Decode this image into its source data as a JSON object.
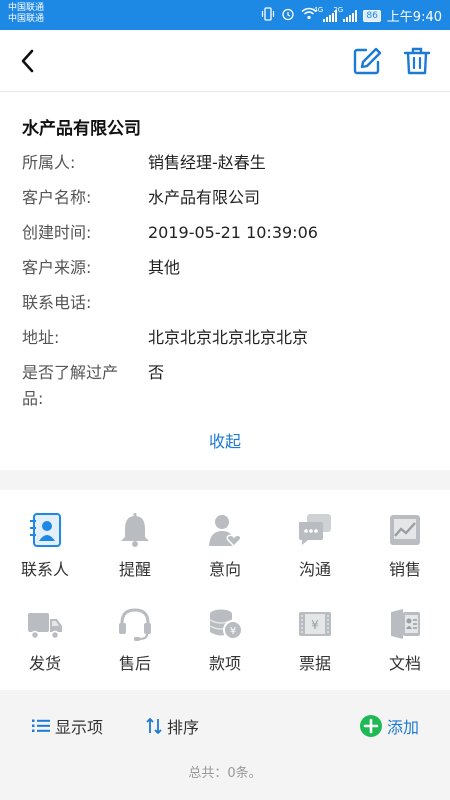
{
  "status_bar": {
    "carrier_1": "中国联通",
    "carrier_2": "中国联通",
    "signal_1_tag": "4G",
    "signal_2_tag": "2G",
    "battery": "86",
    "time": "上午9:40"
  },
  "colors": {
    "accent": "#1e88e5",
    "link": "#1c7ad4",
    "add_green": "#1db954"
  },
  "header": {
    "back_icon": "chevron-left-icon",
    "edit_icon": "edit-icon",
    "delete_icon": "trash-icon"
  },
  "customer": {
    "title": "水产品有限公司",
    "fields": [
      {
        "label": "所属人:",
        "value": "销售经理-赵春生"
      },
      {
        "label": "客户名称:",
        "value": "水产品有限公司"
      },
      {
        "label": "创建时间:",
        "value": "2019-05-21 10:39:06"
      },
      {
        "label": "客户来源:",
        "value": "其他"
      },
      {
        "label": "联系电话:",
        "value": ""
      },
      {
        "label": "地址:",
        "value": "北京北京北京北京北京"
      },
      {
        "label": "是否了解过产品:",
        "value": "否"
      }
    ],
    "collapse_label": "收起"
  },
  "grid": [
    {
      "label": "联系人",
      "icon": "contact-icon"
    },
    {
      "label": "提醒",
      "icon": "bell-icon"
    },
    {
      "label": "意向",
      "icon": "intent-icon"
    },
    {
      "label": "沟通",
      "icon": "chat-icon"
    },
    {
      "label": "销售",
      "icon": "sales-chart-icon"
    },
    {
      "label": "发货",
      "icon": "truck-icon"
    },
    {
      "label": "售后",
      "icon": "headset-icon"
    },
    {
      "label": "款项",
      "icon": "coins-icon"
    },
    {
      "label": "票据",
      "icon": "receipt-icon"
    },
    {
      "label": "文档",
      "icon": "document-icon"
    }
  ],
  "toolbar": {
    "display_label": "显示项",
    "sort_label": "排序",
    "add_label": "添加",
    "total_text": "总共：0条。"
  }
}
